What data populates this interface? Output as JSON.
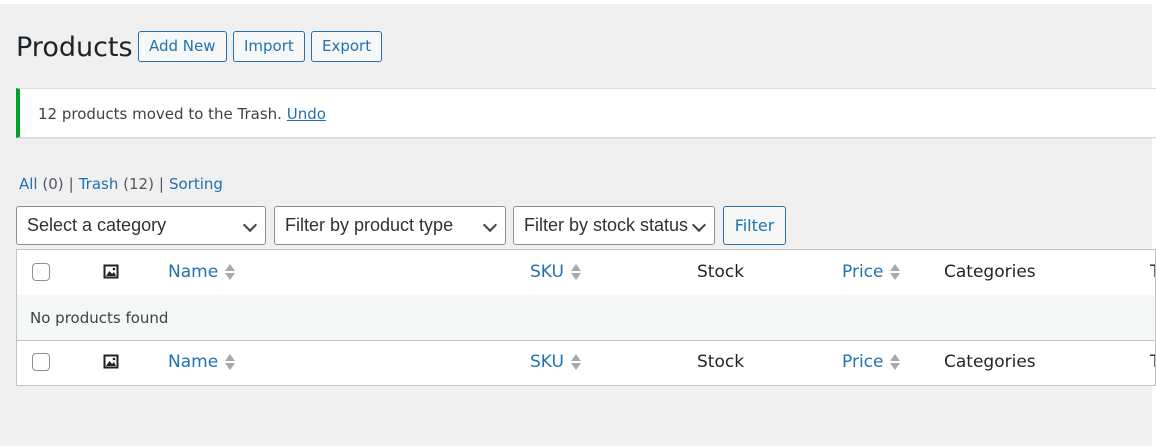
{
  "header": {
    "title": "Products",
    "buttons": [
      "Add New",
      "Import",
      "Export"
    ]
  },
  "notice": {
    "message": "12 products moved to the Trash.",
    "undo_label": "Undo",
    "accent_color": "#00a32a"
  },
  "views": {
    "all_label": "All",
    "all_count": "(0)",
    "trash_label": "Trash",
    "trash_count": "(12)",
    "sorting_label": "Sorting",
    "separator": "|"
  },
  "filters": {
    "category": "Select a category",
    "product_type": "Filter by product type",
    "stock_status": "Filter by stock status",
    "filter_button": "Filter"
  },
  "table": {
    "columns": {
      "thumb_icon": "image-icon",
      "name": "Name",
      "sku": "SKU",
      "stock": "Stock",
      "price": "Price",
      "categories": "Categories",
      "cut_off": "T"
    },
    "empty_message": "No products found"
  },
  "colors": {
    "link": "#2271b1",
    "background": "#f0f0f1"
  }
}
